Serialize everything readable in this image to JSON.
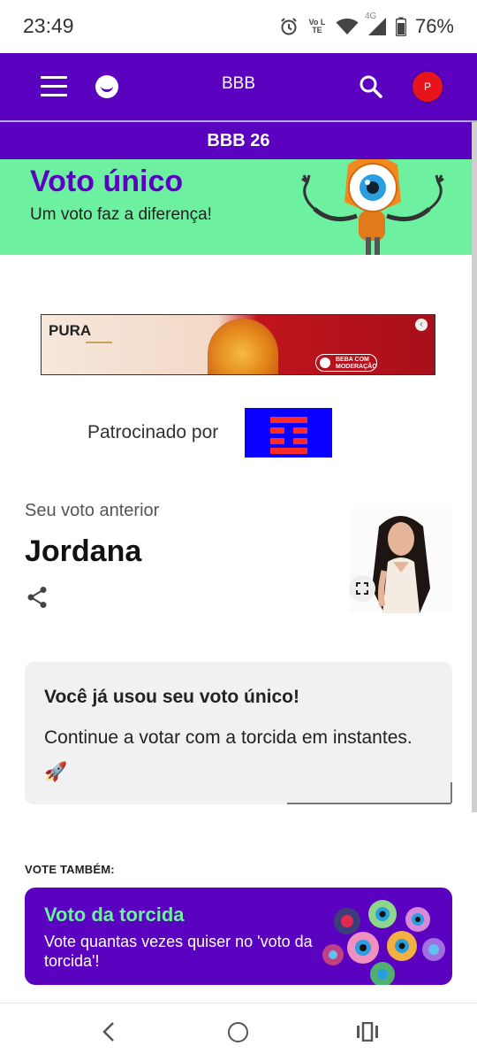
{
  "status_bar": {
    "time": "23:49",
    "network": "4G",
    "volte": "Vo LTE",
    "battery": "76%"
  },
  "header": {
    "title": "BBB",
    "avatar_initial": "P"
  },
  "subheader": {
    "title": "BBB 26"
  },
  "hero": {
    "title": "Voto único",
    "subtitle": "Um voto faz a diferença!"
  },
  "ad": {
    "brand_text": "PURA",
    "badge_text": "BEBA COM MODERAÇÃO",
    "close_glyph": "‹"
  },
  "sponsor": {
    "label": "Patrocinado por"
  },
  "previous_vote": {
    "label": "Seu voto anterior",
    "name": "Jordana"
  },
  "info_card": {
    "title": "Você já usou seu voto único!",
    "text": "Continue a votar com a torcida em instantes. 🚀"
  },
  "also": {
    "label": "VOTE TAMBÉM:"
  },
  "torcida_card": {
    "title": "Voto da torcida",
    "text": "Vote quantas vezes quiser no 'voto da torcida'!"
  },
  "colors": {
    "brand_purple": "#5a02c0",
    "hero_green": "#6df0a0",
    "avatar_red": "#e8141c",
    "sponsor_blue": "#0a00ff"
  },
  "icons": [
    "alarm-icon",
    "wifi-icon",
    "signal-icon",
    "battery-icon",
    "menu-icon",
    "logo-icon",
    "search-icon",
    "share-icon",
    "expand-icon",
    "back-icon",
    "home-icon",
    "recents-icon"
  ]
}
